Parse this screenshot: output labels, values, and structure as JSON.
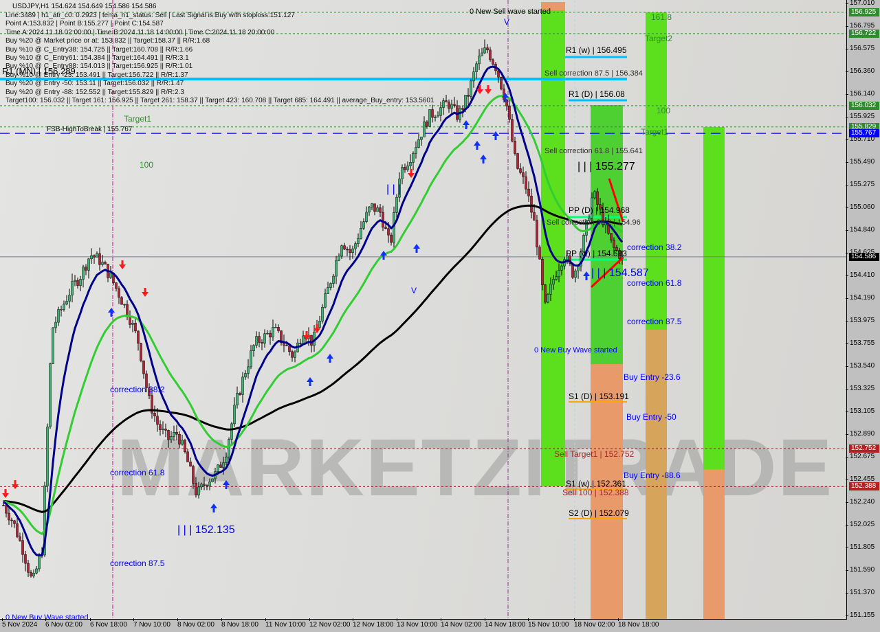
{
  "header": {
    "symbol_line": "USDJPY,H1  154.624 154.649 154.586 154.586",
    "info_lines": [
      "Line:3489 | h1_atr_c0: 0.2923 | tema_h1_status: Sell | Last Signal is:Buy with stoploss:151.127",
      "Point A:153.832 | Point B:155.277 | Point C:154.587",
      "Time A:2024.11.18 02:00:00 | Time B:2024.11.18 14:00:00 | Time C:2024.11.18 20:00:00",
      "Buy %20 @ Market price or at: 153.832 || Target:158.37 || R/R:1.68",
      "Buy %10 @ C_Entry38: 154.725 || Target:160.708 || R/R:1.66",
      "Buy %10 @ C_Entry61: 154.384 || Target:164.491 || R/R:3.1",
      "Buy %10 @ C_Entry88: 154.013 || Target:156.925 || R/R:1.01",
      "Buy %10 @ Entry -23: 153.491 || Target:156.722 || R/R:1.37",
      "Buy %20 @ Entry -50: 153.11 || Target:156.032 || R/R:1.47",
      "Buy %20 @ Entry -88: 152.552 || Target:155.829 || R/R:2.3",
      "Target100: 156.032 || Target 161: 156.925 || Target 261: 158.37 || Target 423: 160.708 || Target 685: 164.491 || average_Buy_entry: 153.5601"
    ]
  },
  "labels": {
    "new_sell_wave": "0 New Sell wave started",
    "r1_w": "R1 (w) | 156.495",
    "sell_corr_875": "Sell correction 87.5 | 156.384",
    "r1_d": "R1 (D) | 156.08",
    "r1_mn": "R1 (MN) | 156.289",
    "fib_1618": "161.8",
    "target2": "Target2",
    "fib_100_right": "100",
    "target1_right": "Target1",
    "target1_left": "Target1",
    "fib_100_left": "100",
    "fsb_high": "FSB-HighToBreak | 155.767",
    "sell_corr_618": "Sell correction 61.8 | 155.641",
    "point_b": "| | | 155.277",
    "pp_d": "PP (D) | 154.968",
    "sell_corr_382": "Sell correction 38.2 | 154.96",
    "corr_382_right": "correction 38.2",
    "pp_w": "PP (w) | 154.583",
    "point_c": "| | | 154.587",
    "corr_618_right": "correction 61.8",
    "corr_875_right": "correction 87.5",
    "new_buy_wave_right": "0 New Buy Wave started",
    "buy_entry_236": "Buy Entry -23.6",
    "s1_d": "S1 (D) | 153.191",
    "buy_entry_50": "Buy Entry -50",
    "sell_target1": "Sell Target1 | 152.752",
    "buy_entry_886": "Buy Entry -88.6",
    "s1_w": "S1 (w) | 152.361",
    "sell_100": "Sell 100 | 152.388",
    "s2_d": "S2 (D) | 152.079",
    "point_low": "| | | 152.135",
    "corr_382_left": "correction 38.2",
    "corr_618_left": "correction 61.8",
    "corr_875_left": "correction 87.5",
    "new_buy_wave_left": "0 New Buy Wave started",
    "triple_bar": "| | |",
    "v_mark_top": "V",
    "v_mark_mid": "V"
  },
  "watermark": "MARKETZITRADE",
  "colors": {
    "bull_candle": "#3cb371",
    "bear_candle": "#b22234",
    "green_zone": "#5ce01e",
    "orange_zone": "#e89a6a",
    "fast_ma": "#00008b",
    "mid_ma": "#32cd32",
    "slow_ma": "#000000",
    "pivot_line": "#00bfff",
    "support_line": "#ffa500"
  },
  "chart_data": {
    "type": "candlestick",
    "title": "USDJPY,H1",
    "ylim": [
      151.155,
      157.01
    ],
    "grid": false,
    "close_path": [
      152.21,
      152.05,
      151.79,
      151.46,
      151.79,
      153.89,
      154.09,
      154.28,
      154.41,
      154.61,
      154.55,
      154.41,
      154.22,
      154.02,
      153.76,
      153.23,
      152.97,
      152.84,
      152.9,
      152.64,
      152.31,
      152.44,
      152.51,
      152.71,
      153.17,
      153.49,
      153.76,
      153.82,
      153.89,
      153.76,
      153.63,
      153.89,
      153.76,
      154.09,
      154.41,
      154.74,
      154.61,
      154.87,
      155.07,
      155.01,
      154.68,
      155.4,
      155.53,
      155.73,
      155.93,
      155.99,
      156.06,
      155.93,
      156.12,
      156.45,
      156.58,
      156.39,
      156.06,
      155.47,
      155.27,
      154.87,
      154.09,
      154.41,
      154.61,
      154.41,
      154.74,
      155.2,
      154.94,
      154.68,
      154.586
    ],
    "y_ticks": [
      "157.010",
      "156.795",
      "156.575",
      "156.360",
      "156.140",
      "155.925",
      "155.710",
      "155.490",
      "155.275",
      "155.060",
      "154.840",
      "154.625",
      "154.410",
      "154.190",
      "153.975",
      "153.755",
      "153.540",
      "153.325",
      "153.105",
      "152.890",
      "152.675",
      "152.455",
      "152.240",
      "152.025",
      "151.805",
      "151.590",
      "151.370",
      "151.155"
    ],
    "x_ticks": [
      "5 Nov 2024",
      "6 Nov 02:00",
      "6 Nov 18:00",
      "7 Nov 10:00",
      "8 Nov 02:00",
      "8 Nov 18:00",
      "11 Nov 10:00",
      "12 Nov 02:00",
      "12 Nov 18:00",
      "13 Nov 10:00",
      "14 Nov 02:00",
      "14 Nov 18:00",
      "15 Nov 10:00",
      "18 Nov 02:00",
      "18 Nov 18:00"
    ],
    "price_badges": [
      {
        "value": "156.925",
        "color": "#2e8b2e"
      },
      {
        "value": "156.722",
        "color": "#2e8b2e"
      },
      {
        "value": "156.032",
        "color": "#2e8b2e"
      },
      {
        "value": "155.829",
        "color": "#2e8b2e"
      },
      {
        "value": "155.767",
        "color": "#0000ff"
      },
      {
        "value": "154.586",
        "color": "#000000"
      },
      {
        "value": "152.752",
        "color": "#b22222"
      },
      {
        "value": "152.388",
        "color": "#b22222"
      }
    ],
    "current_price": 154.586
  }
}
